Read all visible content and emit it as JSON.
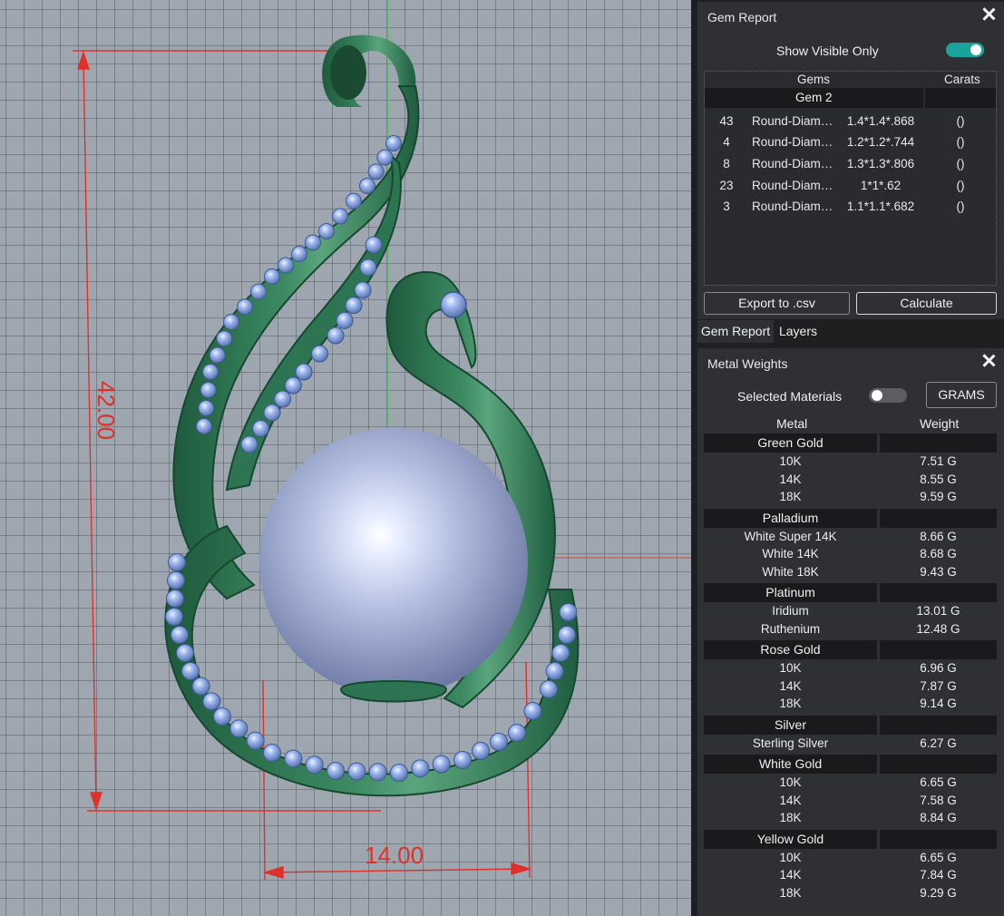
{
  "viewport": {
    "dim_height": "42.00",
    "dim_width": "14.00",
    "colors": {
      "metal": "#2f7a55",
      "gems": "#8aa8e0",
      "pearl": "#b7c3e4",
      "dimension": "#e0302a"
    }
  },
  "gem_report": {
    "title": "Gem Report",
    "show_visible_label": "Show Visible Only",
    "show_visible_on": true,
    "col_gems": "Gems",
    "col_carats": "Carats",
    "group": "Gem 2",
    "rows": [
      {
        "count": "43",
        "name": "Round-Diamond",
        "size": "1.4*1.4*.868",
        "carats": "()"
      },
      {
        "count": "4",
        "name": "Round-Diamond",
        "size": "1.2*1.2*.744",
        "carats": "()"
      },
      {
        "count": "8",
        "name": "Round-Diamond",
        "size": "1.3*1.3*.806",
        "carats": "()"
      },
      {
        "count": "23",
        "name": "Round-Diamond",
        "size": "1*1*.62",
        "carats": "()"
      },
      {
        "count": "3",
        "name": "Round-Diamond",
        "size": "1.1*1.1*.682",
        "carats": "()"
      }
    ],
    "export_label": "Export to .csv",
    "calculate_label": "Calculate"
  },
  "tabs": {
    "gem_report": "Gem Report",
    "layers": "Layers"
  },
  "metal_weights": {
    "title": "Metal Weights",
    "selected_materials_label": "Selected Materials",
    "selected_materials_on": false,
    "units_label": "GRAMS",
    "col_metal": "Metal",
    "col_weight": "Weight",
    "groups": [
      {
        "name": "Green Gold",
        "rows": [
          {
            "name": "10K",
            "weight": "7.51 G"
          },
          {
            "name": "14K",
            "weight": "8.55 G"
          },
          {
            "name": "18K",
            "weight": "9.59 G"
          }
        ]
      },
      {
        "name": "Palladium",
        "rows": [
          {
            "name": "White Super 14K",
            "weight": "8.66 G"
          },
          {
            "name": "White 14K",
            "weight": "8.68 G"
          },
          {
            "name": "White 18K",
            "weight": "9.43 G"
          }
        ]
      },
      {
        "name": "Platinum",
        "rows": [
          {
            "name": "Iridium",
            "weight": "13.01 G"
          },
          {
            "name": "Ruthenium",
            "weight": "12.48 G"
          }
        ]
      },
      {
        "name": "Rose Gold",
        "rows": [
          {
            "name": "10K",
            "weight": "6.96 G"
          },
          {
            "name": "14K",
            "weight": "7.87 G"
          },
          {
            "name": "18K",
            "weight": "9.14 G"
          }
        ]
      },
      {
        "name": "Silver",
        "rows": [
          {
            "name": "Sterling Silver",
            "weight": "6.27 G"
          }
        ]
      },
      {
        "name": "White Gold",
        "rows": [
          {
            "name": "10K",
            "weight": "6.65 G"
          },
          {
            "name": "14K",
            "weight": "7.58 G"
          },
          {
            "name": "18K",
            "weight": "8.84 G"
          }
        ]
      },
      {
        "name": "Yellow Gold",
        "rows": [
          {
            "name": "10K",
            "weight": "6.65 G"
          },
          {
            "name": "14K",
            "weight": "7.84 G"
          },
          {
            "name": "18K",
            "weight": "9.29 G"
          }
        ]
      }
    ]
  }
}
